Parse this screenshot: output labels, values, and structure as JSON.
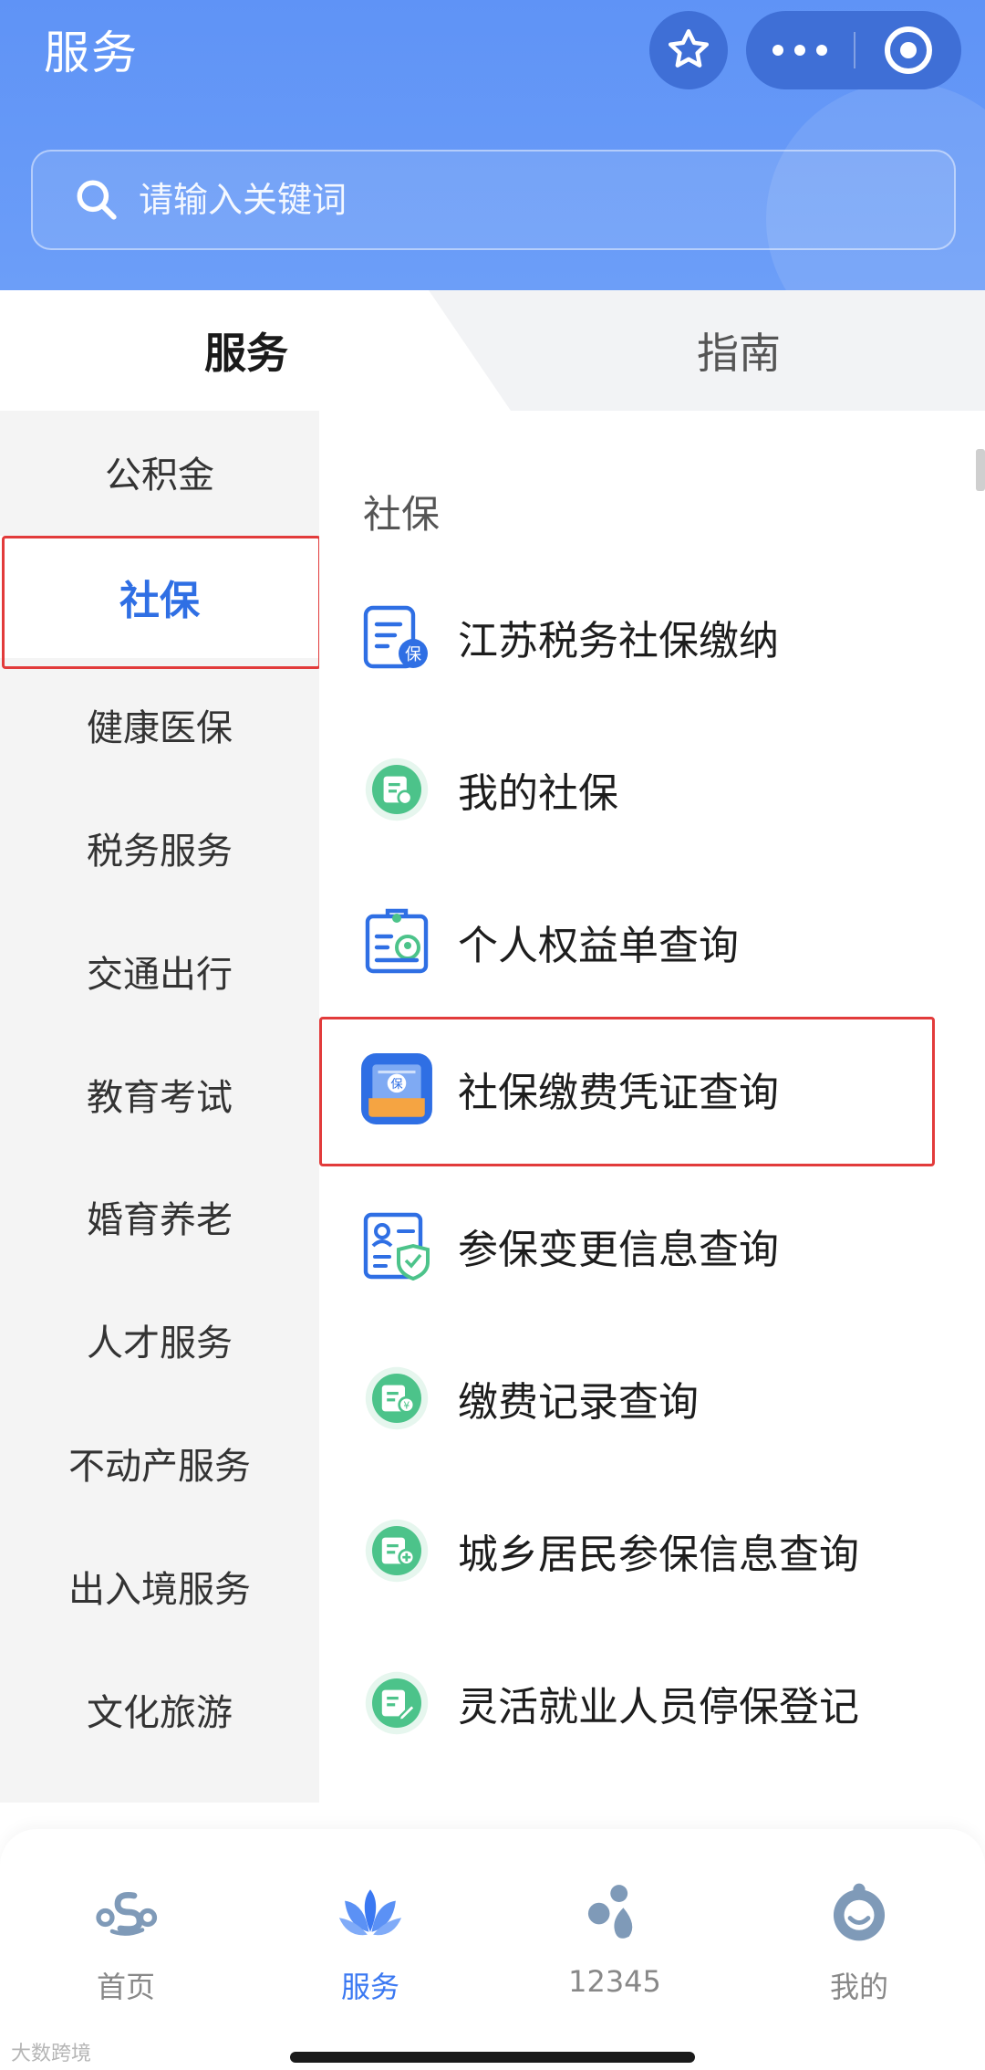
{
  "header": {
    "title": "服务",
    "search_placeholder": "请输入关键词"
  },
  "tabs": [
    {
      "label": "服务",
      "active": true
    },
    {
      "label": "指南",
      "active": false
    }
  ],
  "categories": [
    {
      "label": "公积金"
    },
    {
      "label": "社保",
      "active": true
    },
    {
      "label": "健康医保"
    },
    {
      "label": "税务服务"
    },
    {
      "label": "交通出行"
    },
    {
      "label": "教育考试"
    },
    {
      "label": "婚育养老"
    },
    {
      "label": "人才服务"
    },
    {
      "label": "不动产服务"
    },
    {
      "label": "出入境服务"
    },
    {
      "label": "文化旅游"
    }
  ],
  "section": {
    "title": "社保",
    "items": [
      {
        "label": "江苏税务社保缴纳",
        "icon": "tax-document-icon"
      },
      {
        "label": "我的社保",
        "icon": "social-security-card-icon"
      },
      {
        "label": "个人权益单查询",
        "icon": "rights-clipboard-icon"
      },
      {
        "label": "社保缴费凭证查询",
        "icon": "payment-voucher-icon",
        "highlighted": true
      },
      {
        "label": "参保变更信息查询",
        "icon": "insurance-change-icon"
      },
      {
        "label": "缴费记录查询",
        "icon": "payment-record-icon"
      },
      {
        "label": "城乡居民参保信息查询",
        "icon": "resident-insurance-icon"
      },
      {
        "label": "灵活就业人员停保登记",
        "icon": "stop-insurance-icon"
      }
    ]
  },
  "bottom_nav": [
    {
      "label": "首页",
      "icon": "home-logo-icon"
    },
    {
      "label": "服务",
      "icon": "lotus-icon",
      "active": true
    },
    {
      "label": "12345",
      "icon": "hotline-icon"
    },
    {
      "label": "我的",
      "icon": "profile-icon"
    }
  ],
  "watermark": "大数跨境",
  "colors": {
    "header_blue": "#6c9ef8",
    "accent_blue": "#3a78f2",
    "highlight_red": "#e23b3b",
    "icon_green": "#4cc38a"
  }
}
